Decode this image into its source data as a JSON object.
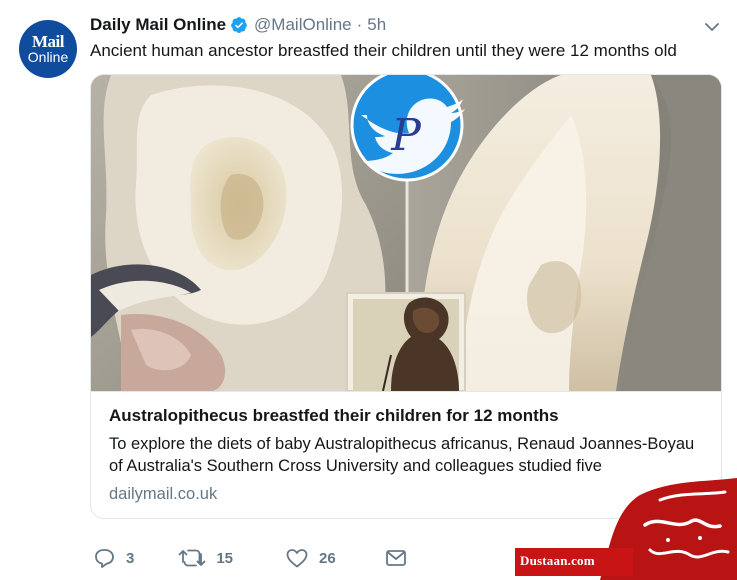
{
  "tweet": {
    "avatar": {
      "line1": "Mail",
      "line2": "Online",
      "color": "#0f4c9e"
    },
    "display_name": "Daily Mail Online",
    "handle": "@MailOnline",
    "separator": "·",
    "time": "5h",
    "text": "Ancient human ancestor breastfed their children until they were 12 months old"
  },
  "card": {
    "title": "Australopithecus breastfed their children for 12 months",
    "description": "To explore the diets of baby Australopithecus africanus, Renaud Joannes-Boyau of Australia's Southern Cross University and colleagues studied five",
    "domain": "dailymail.co.uk",
    "image_icon": "twitter-bird-icon",
    "image_icon_letter": "P"
  },
  "actions": {
    "replies": "3",
    "retweets": "15",
    "likes": "26"
  },
  "watermark": {
    "site": "Dustaan.com",
    "script_text": "مجله دوستان",
    "color": "#c81414"
  },
  "colors": {
    "twitter_blue": "#1da1f2",
    "text": "#14171a",
    "secondary": "#657786",
    "border": "#e1e8ed"
  }
}
